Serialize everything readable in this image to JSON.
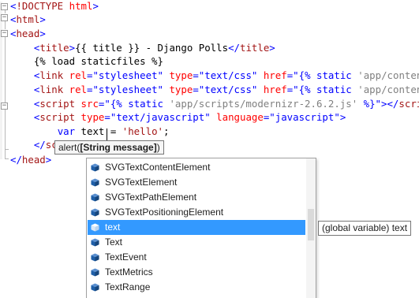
{
  "code_lines": [
    {
      "tokens": [
        {
          "text": "<",
          "kind": "punct"
        },
        {
          "text": "!DOCTYPE ",
          "kind": "tag"
        },
        {
          "text": "html",
          "kind": "attr"
        },
        {
          "text": ">",
          "kind": "punct"
        }
      ]
    },
    {
      "tokens": [
        {
          "text": "<",
          "kind": "punct"
        },
        {
          "text": "html",
          "kind": "tag"
        },
        {
          "text": ">",
          "kind": "punct"
        }
      ]
    },
    {
      "tokens": [
        {
          "text": "<",
          "kind": "punct"
        },
        {
          "text": "head",
          "kind": "tag"
        },
        {
          "text": ">",
          "kind": "punct"
        }
      ]
    },
    {
      "tokens": [
        {
          "text": "    ",
          "kind": "text"
        },
        {
          "text": "<",
          "kind": "punct"
        },
        {
          "text": "title",
          "kind": "tag"
        },
        {
          "text": ">",
          "kind": "punct"
        },
        {
          "text": "{{ title }} - Django Polls",
          "kind": "text"
        },
        {
          "text": "</",
          "kind": "punct"
        },
        {
          "text": "title",
          "kind": "tag"
        },
        {
          "text": ">",
          "kind": "punct"
        }
      ]
    },
    {
      "tokens": [
        {
          "text": "    ",
          "kind": "text"
        },
        {
          "text": "{% load staticfiles %}",
          "kind": "text"
        }
      ]
    },
    {
      "tokens": [
        {
          "text": "    ",
          "kind": "text"
        },
        {
          "text": "<",
          "kind": "punct"
        },
        {
          "text": "link",
          "kind": "tag"
        },
        {
          "text": " rel",
          "kind": "attr"
        },
        {
          "text": "=",
          "kind": "punct"
        },
        {
          "text": "\"stylesheet\"",
          "kind": "val"
        },
        {
          "text": " type",
          "kind": "attr"
        },
        {
          "text": "=",
          "kind": "punct"
        },
        {
          "text": "\"text/css\"",
          "kind": "val"
        },
        {
          "text": " href",
          "kind": "attr"
        },
        {
          "text": "=",
          "kind": "punct"
        },
        {
          "text": "\"{% static ",
          "kind": "val"
        },
        {
          "text": "'app/content/bo",
          "kind": "tmplstr"
        }
      ]
    },
    {
      "tokens": [
        {
          "text": "    ",
          "kind": "text"
        },
        {
          "text": "<",
          "kind": "punct"
        },
        {
          "text": "link",
          "kind": "tag"
        },
        {
          "text": " rel",
          "kind": "attr"
        },
        {
          "text": "=",
          "kind": "punct"
        },
        {
          "text": "\"stylesheet\"",
          "kind": "val"
        },
        {
          "text": " type",
          "kind": "attr"
        },
        {
          "text": "=",
          "kind": "punct"
        },
        {
          "text": "\"text/css\"",
          "kind": "val"
        },
        {
          "text": " href",
          "kind": "attr"
        },
        {
          "text": "=",
          "kind": "punct"
        },
        {
          "text": "\"{% static ",
          "kind": "val"
        },
        {
          "text": "'app/content/si",
          "kind": "tmplstr"
        }
      ]
    },
    {
      "tokens": [
        {
          "text": "    ",
          "kind": "text"
        },
        {
          "text": "<",
          "kind": "punct"
        },
        {
          "text": "script",
          "kind": "tag"
        },
        {
          "text": " src",
          "kind": "attr"
        },
        {
          "text": "=",
          "kind": "punct"
        },
        {
          "text": "\"{% static ",
          "kind": "val"
        },
        {
          "text": "'app/scripts/modernizr-2.6.2.js'",
          "kind": "tmplstr"
        },
        {
          "text": " %}\"",
          "kind": "val"
        },
        {
          "text": "></",
          "kind": "punct"
        },
        {
          "text": "script",
          "kind": "tag"
        },
        {
          "text": ">",
          "kind": "punct"
        }
      ]
    },
    {
      "tokens": [
        {
          "text": "    ",
          "kind": "text"
        },
        {
          "text": "<",
          "kind": "punct"
        },
        {
          "text": "script",
          "kind": "tag"
        },
        {
          "text": " type",
          "kind": "attr"
        },
        {
          "text": "=",
          "kind": "punct"
        },
        {
          "text": "\"text/javascript\"",
          "kind": "val"
        },
        {
          "text": " language",
          "kind": "attr"
        },
        {
          "text": "=",
          "kind": "punct"
        },
        {
          "text": "\"javascript\"",
          "kind": "val"
        },
        {
          "text": ">",
          "kind": "punct"
        }
      ]
    },
    {
      "tokens": [
        {
          "text": "        ",
          "kind": "text"
        },
        {
          "text": "var",
          "kind": "kw"
        },
        {
          "text": " text = ",
          "kind": "text"
        },
        {
          "text": "'hello'",
          "kind": "str"
        },
        {
          "text": ";",
          "kind": "text"
        }
      ]
    },
    {
      "tokens": [
        {
          "text": "        ",
          "kind": "text"
        },
        {
          "text": "alert(tex",
          "kind": "text"
        }
      ]
    },
    {
      "tokens": [
        {
          "text": "    ",
          "kind": "text"
        },
        {
          "text": "</",
          "kind": "punct"
        },
        {
          "text": "sc",
          "kind": "tag"
        }
      ]
    },
    {
      "tokens": [
        {
          "text": "</",
          "kind": "punct"
        },
        {
          "text": "head",
          "kind": "tag"
        },
        {
          "text": ">",
          "kind": "punct"
        }
      ]
    }
  ],
  "parameter_tip": {
    "prefix": "alert(",
    "param": "[String message]",
    "suffix": ")"
  },
  "completion": {
    "items": [
      {
        "label": "SVGTextContentElement",
        "selected": false
      },
      {
        "label": "SVGTextElement",
        "selected": false
      },
      {
        "label": "SVGTextPathElement",
        "selected": false
      },
      {
        "label": "SVGTextPositioningElement",
        "selected": false
      },
      {
        "label": "text",
        "selected": true
      },
      {
        "label": "Text",
        "selected": false
      },
      {
        "label": "TextEvent",
        "selected": false
      },
      {
        "label": "TextMetrics",
        "selected": false
      },
      {
        "label": "TextRange",
        "selected": false
      }
    ],
    "item_icon": "cube-icon",
    "tooltip": "(global variable) text"
  },
  "colors": {
    "selection": "#3399ff",
    "tag": "#a31515",
    "punct": "#0000ff",
    "attr": "#ff0000",
    "icon": "#1f5fa8"
  }
}
